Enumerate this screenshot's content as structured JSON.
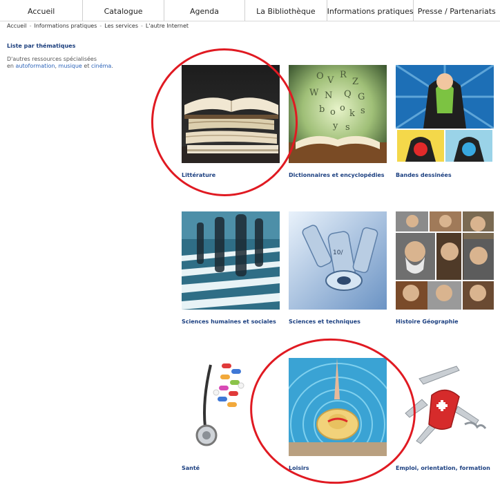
{
  "nav": {
    "items": [
      "Accueil",
      "Catalogue",
      "Agenda",
      "La Bibliothèque",
      "Informations pratiques",
      "Presse / Partenariats"
    ]
  },
  "breadcrumb": {
    "items": [
      "Accueil",
      "Informations pratiques",
      "Les services",
      "L'autre Internet"
    ],
    "separator": "-"
  },
  "sidebar": {
    "title": "Liste par thématiques",
    "desc_line1": "D'autres ressources spécialisées",
    "desc_prefix": "en ",
    "link_autoformation": "autoformation",
    "comma": ", ",
    "link_musique": "musique",
    "and": " et ",
    "link_cinema": "cinéma",
    "period": "."
  },
  "tiles": [
    {
      "label": "Littérature",
      "icon": "books-photo"
    },
    {
      "label": "Dictionnaires et encyclopédies",
      "icon": "open-book-letters-photo"
    },
    {
      "label": "Bandes dessinées",
      "icon": "comic-superhero-photo"
    },
    {
      "label": "Sciences humaines et sociales",
      "icon": "crosswalk-people-photo"
    },
    {
      "label": "Sciences et techniques",
      "icon": "microscope-photo"
    },
    {
      "label": "Histoire Géographie",
      "icon": "portraits-collage-photo"
    },
    {
      "label": "Santé",
      "icon": "stethoscope-pills-photo"
    },
    {
      "label": "Loisirs",
      "icon": "pool-hat-photo"
    },
    {
      "label": "Emploi, orientation, formation",
      "icon": "swiss-knife-photo"
    }
  ],
  "annotations": {
    "circle_color": "#e01a22"
  },
  "colors": {
    "link": "#2a62b8",
    "caption": "#1b3f80"
  }
}
